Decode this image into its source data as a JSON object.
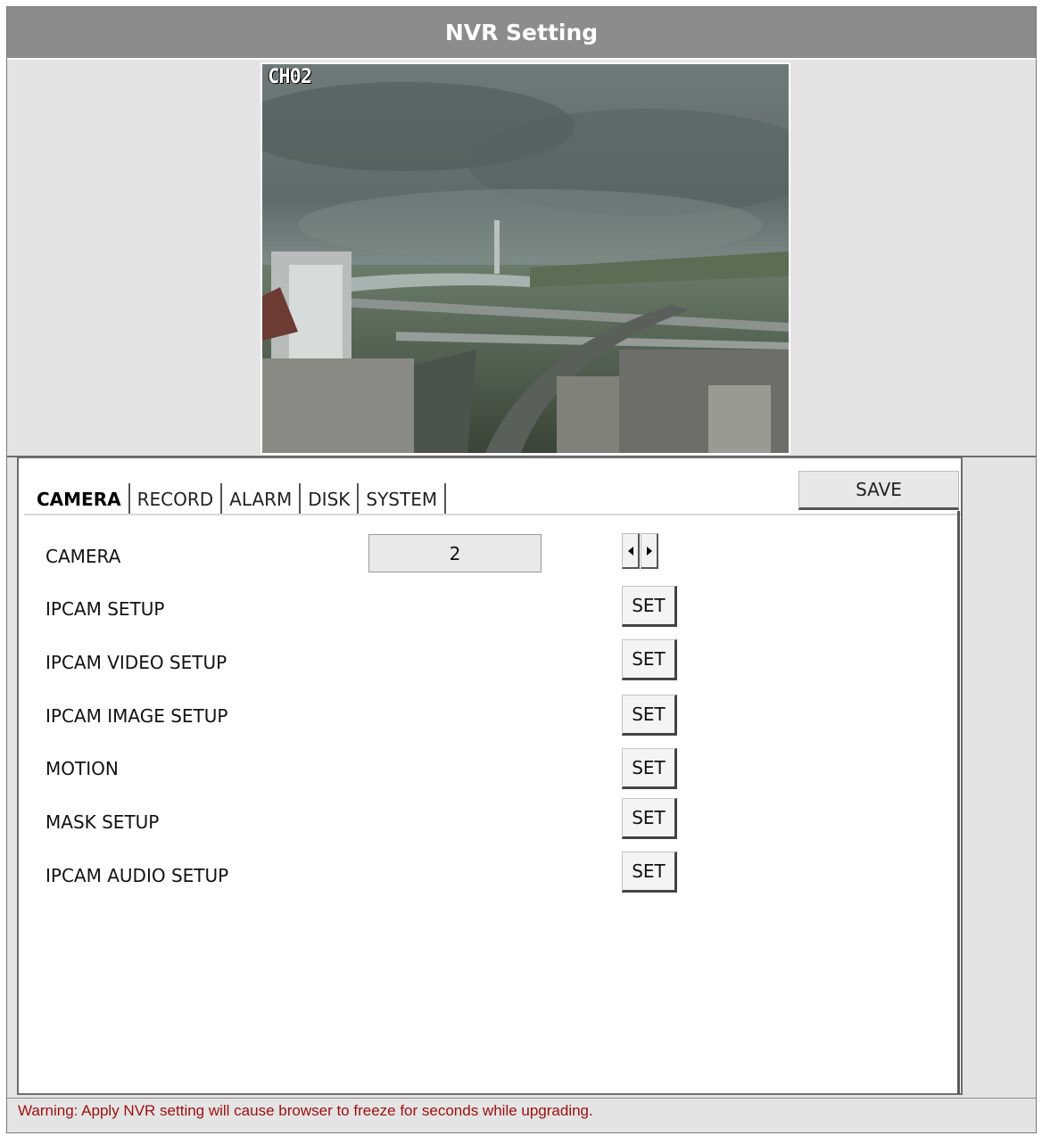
{
  "window": {
    "title": "NVR Setting"
  },
  "preview": {
    "channel_label": "CH02",
    "icon": "camera-feed-image"
  },
  "tabs": [
    {
      "label": "CAMERA",
      "active": true
    },
    {
      "label": "RECORD",
      "active": false
    },
    {
      "label": "ALARM",
      "active": false
    },
    {
      "label": "DISK",
      "active": false
    },
    {
      "label": "SYSTEM",
      "active": false
    }
  ],
  "toolbar": {
    "save_label": "SAVE"
  },
  "camera_row": {
    "label": "CAMERA",
    "value": "2",
    "prev_icon": "arrow-left-icon",
    "next_icon": "arrow-right-icon"
  },
  "settings": [
    {
      "label": "IPCAM SETUP",
      "button": "SET"
    },
    {
      "label": "IPCAM VIDEO SETUP",
      "button": "SET"
    },
    {
      "label": "IPCAM IMAGE SETUP",
      "button": "SET"
    },
    {
      "label": "MOTION",
      "button": "SET"
    },
    {
      "label": "MASK SETUP",
      "button": "SET"
    },
    {
      "label": "IPCAM AUDIO SETUP",
      "button": "SET"
    }
  ],
  "footer": {
    "warning": "Warning: Apply NVR setting will cause browser to freeze for seconds while upgrading."
  },
  "colors": {
    "title_bar": "#8c8c8c",
    "background": "#e4e4e4",
    "warning_text": "#a01010"
  }
}
